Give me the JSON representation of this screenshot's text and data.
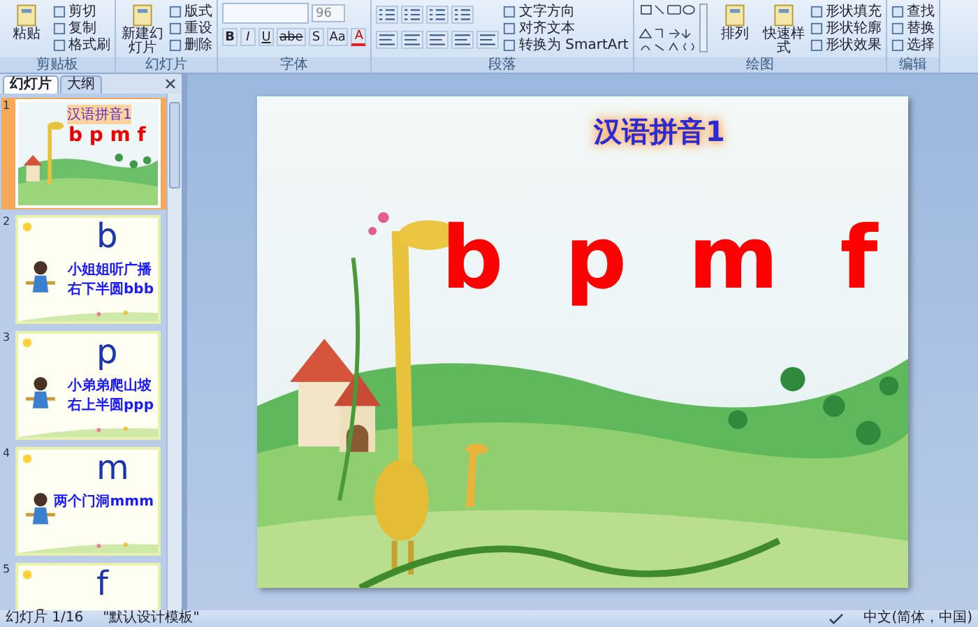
{
  "ribbon": {
    "groups": [
      {
        "label": "剪贴板",
        "kind": "buttons",
        "items": [
          {
            "label": "粘贴",
            "kind": "large"
          },
          {
            "label": "剪切",
            "kind": "small"
          },
          {
            "label": "复制",
            "kind": "small"
          },
          {
            "label": "格式刷",
            "kind": "small"
          }
        ]
      },
      {
        "label": "幻灯片",
        "kind": "buttons",
        "items": [
          {
            "label": "新建幻灯片",
            "kind": "large"
          },
          {
            "label": "版式",
            "kind": "small"
          },
          {
            "label": "重设",
            "kind": "small"
          },
          {
            "label": "删除",
            "kind": "small"
          }
        ]
      },
      {
        "label": "字体",
        "kind": "font",
        "size": "96",
        "buttons": [
          "B",
          "I",
          "U",
          "abe",
          "S",
          "Aa",
          "A"
        ]
      },
      {
        "label": "段落",
        "kind": "paragraph",
        "items": [
          {
            "label": "文字方向"
          },
          {
            "label": "对齐文本"
          },
          {
            "label": "转换为 SmartArt"
          }
        ]
      },
      {
        "label": "绘图",
        "kind": "drawing",
        "items": [
          {
            "label": "排列",
            "kind": "large"
          },
          {
            "label": "快速样式",
            "kind": "large"
          },
          {
            "label": "形状填充",
            "kind": "small"
          },
          {
            "label": "形状轮廓",
            "kind": "small"
          },
          {
            "label": "形状效果",
            "kind": "small"
          }
        ]
      },
      {
        "label": "编辑",
        "kind": "buttons",
        "items": [
          {
            "label": "查找",
            "kind": "small"
          },
          {
            "label": "替换",
            "kind": "small"
          },
          {
            "label": "选择",
            "kind": "small"
          }
        ]
      }
    ]
  },
  "pane": {
    "tabs": [
      {
        "label": "幻灯片",
        "selected": true
      },
      {
        "label": "大纲",
        "selected": false
      }
    ],
    "slides": [
      {
        "number": "1",
        "selected": true,
        "kind": "title",
        "title": "汉语拼音1",
        "letters": "b p m f"
      },
      {
        "number": "2",
        "selected": false,
        "kind": "letter",
        "letter": "b",
        "lines": [
          "小姐姐听广播",
          "右下半圆bbb"
        ]
      },
      {
        "number": "3",
        "selected": false,
        "kind": "letter",
        "letter": "p",
        "lines": [
          "小弟弟爬山坡",
          "右上半圆ppp"
        ]
      },
      {
        "number": "4",
        "selected": false,
        "kind": "letter",
        "letter": "m",
        "lines": [
          "两个门洞mmm"
        ]
      },
      {
        "number": "5",
        "selected": false,
        "kind": "letter",
        "letter": "f"
      }
    ]
  },
  "slide": {
    "title": "汉语拼音1",
    "letters": [
      "b",
      "p",
      "m",
      "f"
    ]
  },
  "status_bar": {
    "slide": "幻灯片 1/16",
    "theme": "\"默认设计模板\"",
    "language": "中文(简体，中国)"
  }
}
